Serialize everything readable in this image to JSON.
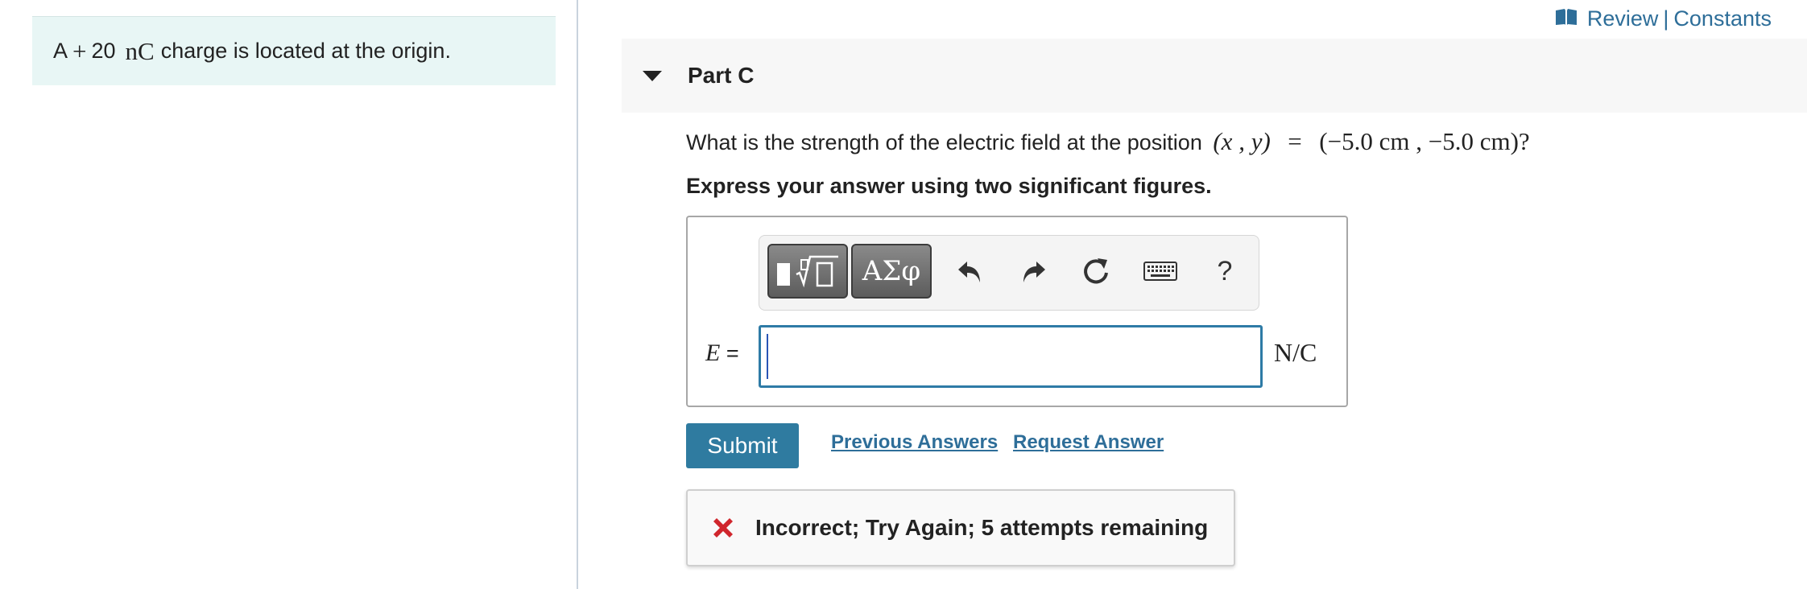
{
  "intro": {
    "prefix": "A",
    "plus": "+",
    "value": "20",
    "unit": "nC",
    "suffix": "charge is located at the origin."
  },
  "header_links": {
    "review": "Review",
    "separator": "|",
    "constants": "Constants"
  },
  "part": {
    "title": "Part C"
  },
  "question": {
    "text": "What is the strength of the electric field at the position",
    "coords": "(x , y)",
    "equals": "=",
    "position": "(−5.0 cm , −5.0 cm)",
    "qmark": "?"
  },
  "instruction": "Express your answer using two significant figures.",
  "toolbar": {
    "greek_label": "ΑΣφ",
    "help_label": "?"
  },
  "answer": {
    "var_label": "E",
    "equals": "=",
    "value": "",
    "units": "N/C"
  },
  "actions": {
    "submit_label": "Submit",
    "previous_answers": "Previous Answers",
    "request_answer": "Request Answer"
  },
  "feedback": {
    "message": "Incorrect; Try Again; 5 attempts remaining"
  },
  "colors": {
    "accent": "#2f7ba0",
    "link": "#2e6e99",
    "intro_bg": "#e8f6f5",
    "error": "#d0262d"
  }
}
